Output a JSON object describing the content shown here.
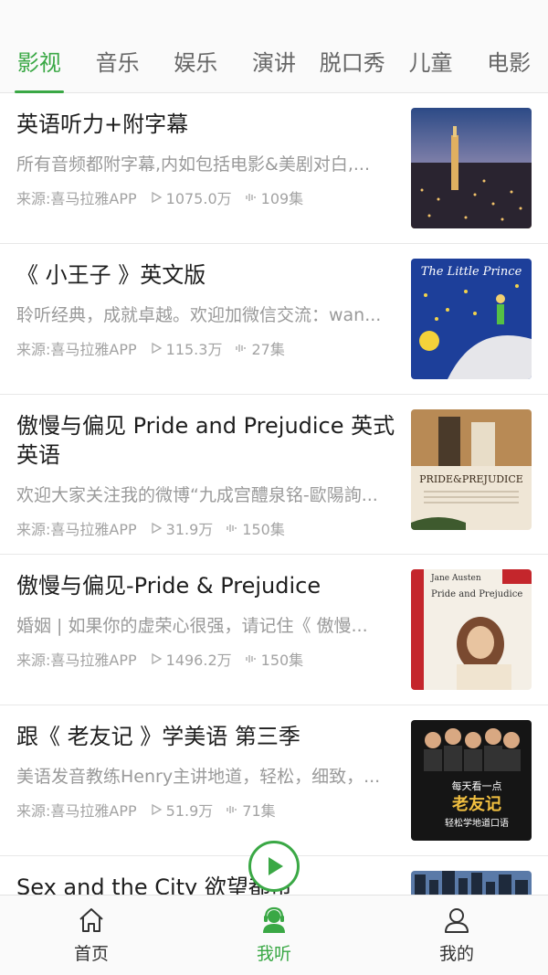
{
  "tabs": [
    "影视",
    "音乐",
    "娱乐",
    "演讲",
    "脱口秀",
    "儿童",
    "电影"
  ],
  "active_tab": 0,
  "items": [
    {
      "title": "英语听力+附字幕",
      "desc": "所有音频都附字幕,内如包括电影&美剧对白,...",
      "source": "来源:喜马拉雅APP",
      "plays": "1075.0万",
      "episodes": "109集"
    },
    {
      "title": "《 小王子 》英文版",
      "desc": "聆听经典，成就卓越。欢迎加微信交流：wan...",
      "source": "来源:喜马拉雅APP",
      "plays": "115.3万",
      "episodes": "27集"
    },
    {
      "title": "傲慢与偏见 Pride and Prejudice 英式英语",
      "desc": "欢迎大家关注我的微博“九成宫醴泉铭-歐陽詢...",
      "source": "来源:喜马拉雅APP",
      "plays": "31.9万",
      "episodes": "150集"
    },
    {
      "title": "傲慢与偏见-Pride & Prejudice",
      "desc": "婚姻 | 如果你的虚荣心很强，请记住《 傲慢...",
      "source": "来源:喜马拉雅APP",
      "plays": "1496.2万",
      "episodes": "150集"
    },
    {
      "title": "跟《 老友记 》学美语 第三季",
      "desc": "美语发音教练Henry主讲地道，轻松，细致，...",
      "source": "来源:喜马拉雅APP",
      "plays": "51.9万",
      "episodes": "71集"
    },
    {
      "title": "Sex and the City 欲望都市",
      "desc": "",
      "source": "",
      "plays": "",
      "episodes": ""
    }
  ],
  "thumb_text": {
    "little_prince": "The Little Prince",
    "pride_title": "PRIDE&PREJUDICE",
    "jane_austen": "Jane Austen",
    "pride_cover": "Pride and Prejudice",
    "friends_line1": "每天看一点",
    "friends_line2": "老友记",
    "friends_line3": "轻松学地道口语"
  },
  "nav": [
    {
      "label": "首页",
      "icon": "home-icon"
    },
    {
      "label": "我听",
      "icon": "headset-user-icon"
    },
    {
      "label": "我的",
      "icon": "user-icon"
    }
  ],
  "active_nav": 1,
  "colors": {
    "accent": "#3aa845",
    "text": "#1e1e1e",
    "muted": "#9a9a9a"
  }
}
